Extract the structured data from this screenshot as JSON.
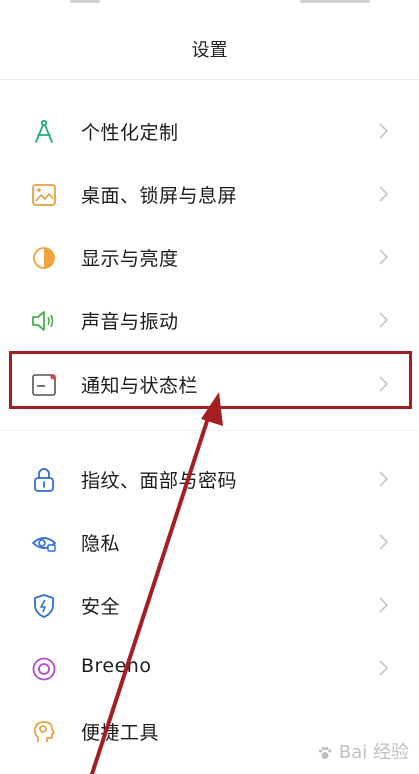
{
  "header": {
    "title": "设置"
  },
  "settings": [
    {
      "label": "个性化定制",
      "icon": "compass-icon",
      "color": "#1fae7a"
    },
    {
      "label": "桌面、锁屏与息屏",
      "icon": "wallpaper-icon",
      "color": "#e8a03a"
    },
    {
      "label": "显示与亮度",
      "icon": "brightness-icon",
      "color": "#f0a23c"
    },
    {
      "label": "声音与振动",
      "icon": "speaker-icon",
      "color": "#48b04a"
    },
    {
      "label": "通知与状态栏",
      "icon": "notification-icon",
      "color": "#555555"
    },
    {
      "label": "指纹、面部与密码",
      "icon": "lock-icon",
      "color": "#2d6fd6"
    },
    {
      "label": "隐私",
      "icon": "privacy-eye-icon",
      "color": "#2d6fd6"
    },
    {
      "label": "安全",
      "icon": "shield-icon",
      "color": "#2d6fd6"
    },
    {
      "label": "Breeno",
      "icon": "breeno-icon",
      "color": "#b04bd0"
    },
    {
      "label": "便捷工具",
      "icon": "assistant-icon",
      "color": "#e8a03a"
    }
  ],
  "annotation": {
    "highlight_color": "#a51f22"
  },
  "watermark": {
    "text": "Bai 经验"
  }
}
